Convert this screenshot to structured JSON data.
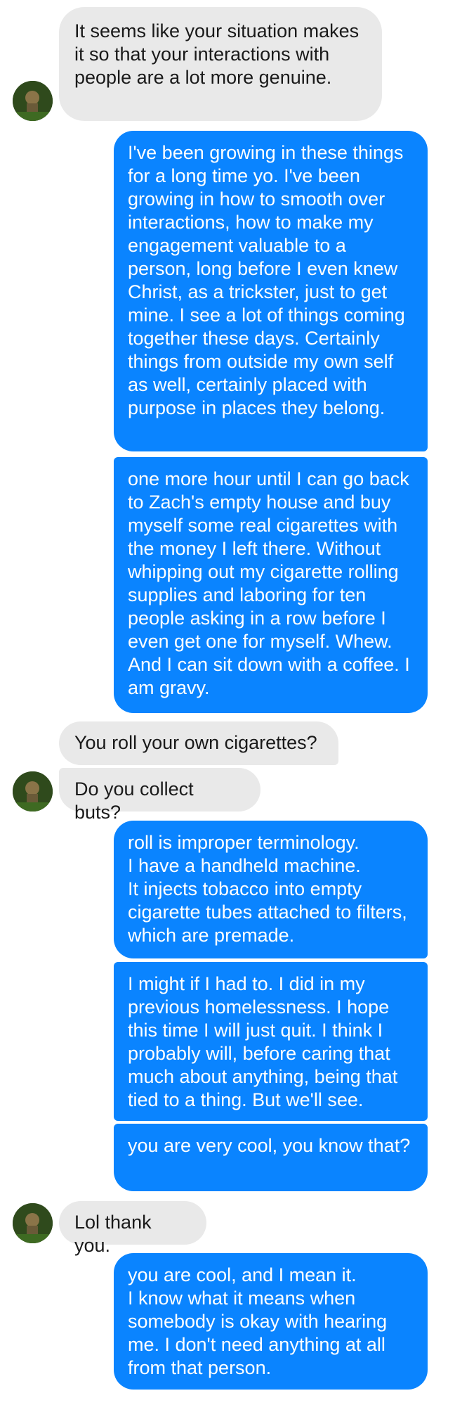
{
  "messages": [
    {
      "side": "in",
      "text": "It seems like your situation makes it so that your interactions with people are a lot more genuine."
    },
    {
      "side": "out",
      "text": "I've been growing in these things for a long time yo. I've been growing in how to smooth over interactions, how to make my engagement valuable to a person, long before I even knew Christ, as a trickster, just to get mine. I see a lot of things coming together these days. Certainly things from outside my own self as well, certainly placed with purpose in places they belong."
    },
    {
      "side": "out",
      "text": "one more hour until I can go back to Zach's empty house and buy myself some real cigarettes with the money I left there. Without whipping out my cigarette rolling supplies and laboring for ten people asking in a row before I even get one for myself. Whew. And I can sit down with a coffee. I am gravy."
    },
    {
      "side": "in",
      "text": "You roll your own cigarettes?"
    },
    {
      "side": "in",
      "text": "Do you collect buts?"
    },
    {
      "side": "out",
      "text": "roll is improper terminology.\nI have a handheld machine.\nIt injects tobacco into empty cigarette tubes attached to filters, which are premade."
    },
    {
      "side": "out",
      "text": "I might if I had to. I did in my previous homelessness. I hope this time I will just quit. I think I probably will, before caring that much about anything, being that tied to a thing. But we'll see."
    },
    {
      "side": "out",
      "text": "you are very cool, you know that?"
    },
    {
      "side": "in",
      "text": "Lol thank you."
    },
    {
      "side": "out",
      "text": "you are cool, and I mean it.\nI know what it means when somebody is okay with hearing me. I don't need anything at all from that person."
    }
  ],
  "colors": {
    "incoming_bubble": "#e9e9e9",
    "outgoing_bubble": "#0a84ff",
    "incoming_text": "#1a1a1a",
    "outgoing_text": "#ffffff"
  },
  "icons": {
    "avatar": "contact-avatar-photo"
  }
}
